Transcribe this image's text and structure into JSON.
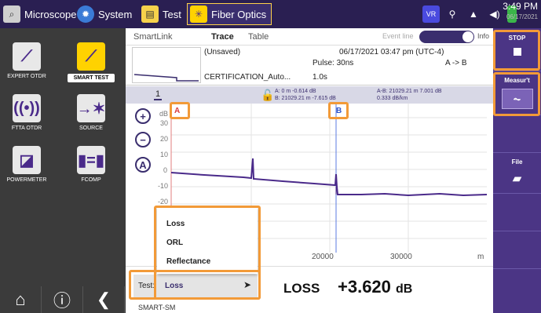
{
  "topbar": {
    "microscope": "Microscope",
    "system": "System",
    "test": "Test",
    "fiber_optics": "Fiber Optics",
    "time": "3:49 PM",
    "date": "06/17/2021"
  },
  "sidebar": {
    "apps": [
      {
        "label": "EXPERT OTDR"
      },
      {
        "label": "SMART TEST"
      },
      {
        "label": "FTTA OTDR"
      },
      {
        "label": "SOURCE"
      },
      {
        "label": "POWERMETER"
      },
      {
        "label": "FCOMP"
      }
    ]
  },
  "tabs": {
    "smartlink": "SmartLink",
    "trace": "Trace",
    "table": "Table",
    "event_line": "Event line",
    "info": "Info"
  },
  "header": {
    "file": "(Unsaved)",
    "datetime": "06/17/2021 03:47 pm (UTC-4)",
    "pulse": "Pulse: 30ns",
    "direction": "A -> B",
    "name": "CERTIFICATION_Auto...",
    "duration": "1.0s"
  },
  "markerbar": {
    "trace_num": "1",
    "a_line1": "A: 0 m -0.614 dB",
    "a_line2": "B: 21029.21 m -7.615 dB",
    "ab_line1": "A-B: 21029.21 m 7.001 dB",
    "ab_line2": "0.333 dB/km"
  },
  "plot": {
    "y_ticks": [
      "dB",
      "30",
      "20",
      "10",
      "0",
      "-10",
      "-20"
    ],
    "x_ticks": [
      "0",
      "20000",
      "30000",
      "m"
    ],
    "marker_a": "A",
    "marker_b": "B"
  },
  "test": {
    "label": "Test:",
    "selected": "Loss",
    "options": [
      "Loss",
      "ORL",
      "Reflectance"
    ]
  },
  "result": {
    "label": "LOSS",
    "value": "+3.620",
    "unit": "dB"
  },
  "right": {
    "stop": "STOP",
    "measure": "Measur't",
    "file": "File"
  },
  "status": {
    "text": "SMART-SM"
  }
}
